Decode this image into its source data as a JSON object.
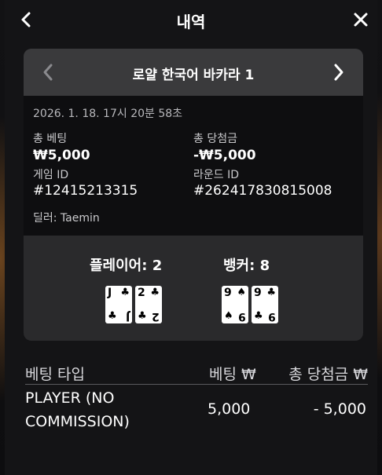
{
  "header": {
    "title": "내역"
  },
  "game": {
    "title": "로얄 한국어 바카라 1"
  },
  "round": {
    "timestamp": "2026. 1. 18. 17시 20분 58초",
    "total_bet_label": "총 베팅",
    "total_bet_value": "₩5,000",
    "total_win_label": "총 당첨금",
    "total_win_value": "-₩5,000",
    "game_id_label": "게임 ID",
    "game_id_value": "#12415213315",
    "round_id_label": "라운드 ID",
    "round_id_value": "#262417830815008",
    "dealer": "딜러: Taemin"
  },
  "hands": {
    "player_label": "플레이어: 2",
    "banker_label": "뱅커: 8",
    "player_cards": [
      {
        "rank": "J",
        "suit": "♣"
      },
      {
        "rank": "2",
        "suit": "♣"
      }
    ],
    "banker_cards": [
      {
        "rank": "9",
        "suit": "♠"
      },
      {
        "rank": "9",
        "suit": "♣"
      }
    ]
  },
  "bets_table": {
    "columns": [
      "베팅 타입",
      "베팅 ₩",
      "총 당첨금 ₩"
    ],
    "rows": [
      {
        "type_line1": "PLAYER (NO",
        "type_line2": "COMMISSION)",
        "bet": "5,000",
        "win": "- 5,000"
      }
    ]
  },
  "colors": {
    "background": "#141416",
    "card_bg": "#2a2a2c",
    "card_header": "#3a3a3c",
    "info_bg": "#0e0e10"
  }
}
